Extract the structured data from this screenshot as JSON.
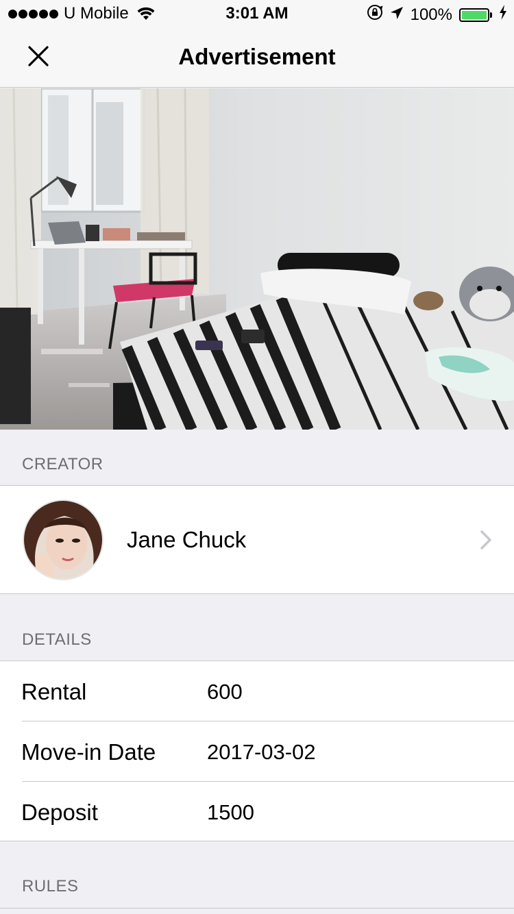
{
  "status_bar": {
    "carrier": "U Mobile",
    "time": "3:01 AM",
    "battery": "100%",
    "signal_bars": 5,
    "battery_level": 1.0,
    "battery_color": "#4cd964"
  },
  "nav": {
    "title": "Advertisement",
    "close_icon": "close-icon"
  },
  "hero": {
    "icon": "room-photo"
  },
  "sections": {
    "creator_header": "CREATOR",
    "details_header": "DETAILS",
    "rules_header": "RULES"
  },
  "creator": {
    "name": "Jane Chuck",
    "chevron_icon": "chevron-right-icon"
  },
  "details": [
    {
      "label": "Rental",
      "value": "600"
    },
    {
      "label": "Move-in Date",
      "value": "2017-03-02"
    },
    {
      "label": "Deposit",
      "value": "1500"
    }
  ],
  "colors": {
    "background": "#efeff4",
    "separator": "#c8c7cc",
    "section_text": "#6d6d72"
  }
}
